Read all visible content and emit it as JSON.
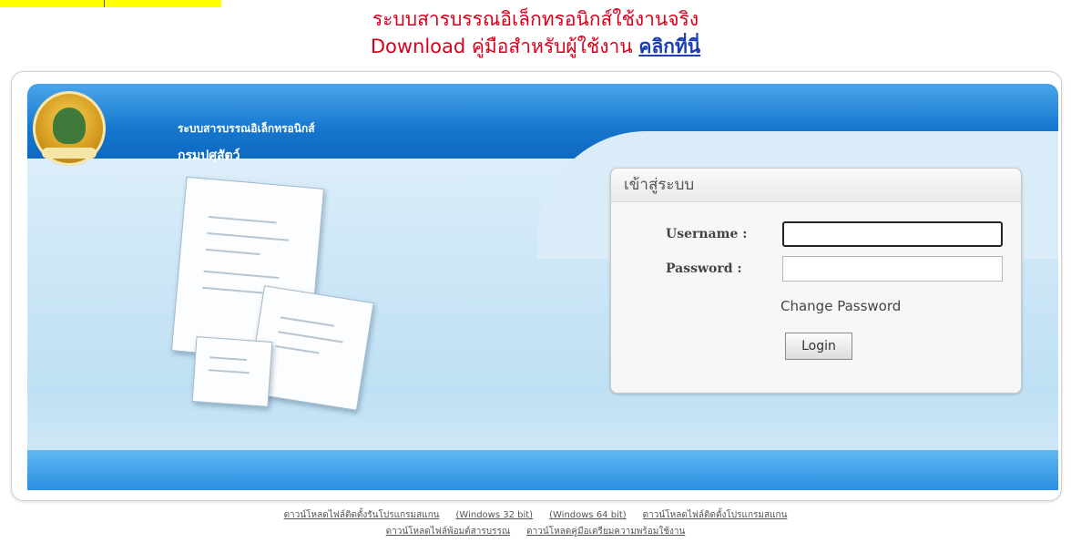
{
  "announcement": {
    "line1": "ระบบสารบรรณอิเล็กทรอนิกส์ใช้งานจริง",
    "line2_prefix": "Download คู่มือสำหรับผู้ใช้งาน ",
    "line2_link": "คลิกที่นี่"
  },
  "header": {
    "system_name": "ระบบสารบรรณอิเล็กทรอนิกส์",
    "department": "กรมปศุสัตว์"
  },
  "login": {
    "title": "เข้าสู่ระบบ",
    "username_label": "Username :",
    "password_label": "Password :",
    "username_value": "",
    "password_value": "",
    "change_password": "Change Password",
    "login_button": "Login"
  },
  "footer": {
    "links_row1": [
      "ดาวน์โหลดไฟล์ติดตั้งรันโปรแกรมสแกน",
      "(Windows 32 bit)",
      "(Windows 64 bit)",
      "ดาวน์โหลดไฟล์ติดตั้งโปรแกรมสแกน"
    ],
    "links_row2": [
      "ดาวน์โหลดไฟล์พ้อมต์สารบรรณ",
      "ดาวน์โหลดคู่มือเตรียมความพร้อมใช้งาน"
    ]
  },
  "colors": {
    "announcement_red": "#d9001c",
    "link_blue": "#1b3fb0",
    "header_blue": "#1677cf"
  }
}
